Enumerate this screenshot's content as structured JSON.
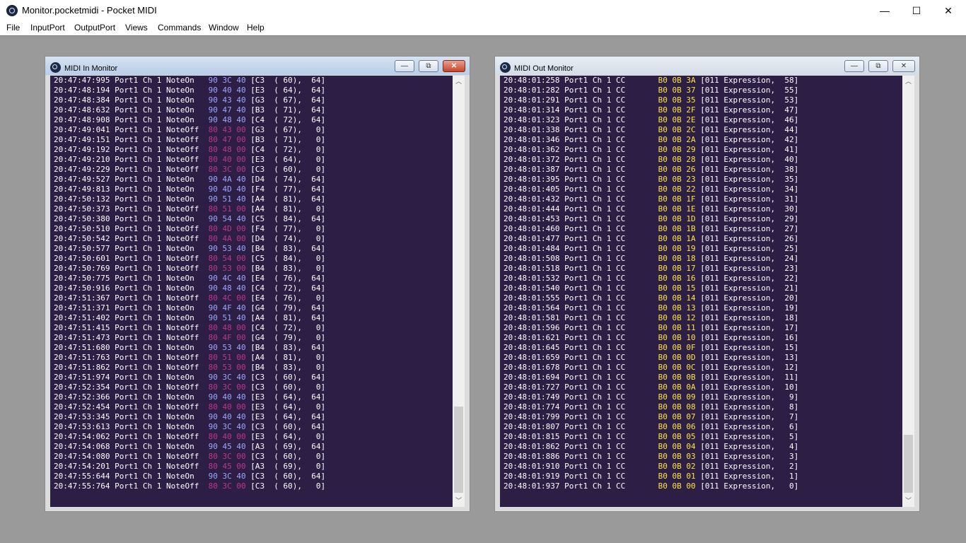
{
  "window": {
    "title": "Monitor.pocketmidi - Pocket MIDI",
    "controls": {
      "minimize": "—",
      "maximize": "☐",
      "close": "✕"
    }
  },
  "menu": [
    "File",
    "InputPort",
    "OutputPort",
    "Views",
    "Commands",
    "Window",
    "Help"
  ],
  "colors": {
    "log_background": "#2c1e45",
    "note_on_bytes": "#9ea7ff",
    "note_off_bytes": "#c0368e",
    "cc_bytes": "#ffe43a"
  },
  "in_monitor": {
    "title": "MIDI In Monitor",
    "buttons": {
      "minimize": "—",
      "restore": "⧉",
      "close": "✕"
    },
    "rows": [
      {
        "time": "20:47:47:995",
        "port": "Port1",
        "ch": "Ch 1",
        "type": "NoteOn ",
        "bytes": "90 3C 40",
        "detail": "[C3  ( 60),  64]"
      },
      {
        "time": "20:47:48:194",
        "port": "Port1",
        "ch": "Ch 1",
        "type": "NoteOn ",
        "bytes": "90 40 40",
        "detail": "[E3  ( 64),  64]"
      },
      {
        "time": "20:47:48:384",
        "port": "Port1",
        "ch": "Ch 1",
        "type": "NoteOn ",
        "bytes": "90 43 40",
        "detail": "[G3  ( 67),  64]"
      },
      {
        "time": "20:47:48:632",
        "port": "Port1",
        "ch": "Ch 1",
        "type": "NoteOn ",
        "bytes": "90 47 40",
        "detail": "[B3  ( 71),  64]"
      },
      {
        "time": "20:47:48:908",
        "port": "Port1",
        "ch": "Ch 1",
        "type": "NoteOn ",
        "bytes": "90 48 40",
        "detail": "[C4  ( 72),  64]"
      },
      {
        "time": "20:47:49:041",
        "port": "Port1",
        "ch": "Ch 1",
        "type": "NoteOff",
        "bytes": "80 43 00",
        "detail": "[G3  ( 67),   0]"
      },
      {
        "time": "20:47:49:151",
        "port": "Port1",
        "ch": "Ch 1",
        "type": "NoteOff",
        "bytes": "80 47 00",
        "detail": "[B3  ( 71),   0]"
      },
      {
        "time": "20:47:49:192",
        "port": "Port1",
        "ch": "Ch 1",
        "type": "NoteOff",
        "bytes": "80 48 00",
        "detail": "[C4  ( 72),   0]"
      },
      {
        "time": "20:47:49:210",
        "port": "Port1",
        "ch": "Ch 1",
        "type": "NoteOff",
        "bytes": "80 40 00",
        "detail": "[E3  ( 64),   0]"
      },
      {
        "time": "20:47:49:229",
        "port": "Port1",
        "ch": "Ch 1",
        "type": "NoteOff",
        "bytes": "80 3C 00",
        "detail": "[C3  ( 60),   0]"
      },
      {
        "time": "20:47:49:527",
        "port": "Port1",
        "ch": "Ch 1",
        "type": "NoteOn ",
        "bytes": "90 4A 40",
        "detail": "[D4  ( 74),  64]"
      },
      {
        "time": "20:47:49:813",
        "port": "Port1",
        "ch": "Ch 1",
        "type": "NoteOn ",
        "bytes": "90 4D 40",
        "detail": "[F4  ( 77),  64]"
      },
      {
        "time": "20:47:50:132",
        "port": "Port1",
        "ch": "Ch 1",
        "type": "NoteOn ",
        "bytes": "90 51 40",
        "detail": "[A4  ( 81),  64]"
      },
      {
        "time": "20:47:50:373",
        "port": "Port1",
        "ch": "Ch 1",
        "type": "NoteOff",
        "bytes": "80 51 00",
        "detail": "[A4  ( 81),   0]"
      },
      {
        "time": "20:47:50:380",
        "port": "Port1",
        "ch": "Ch 1",
        "type": "NoteOn ",
        "bytes": "90 54 40",
        "detail": "[C5  ( 84),  64]"
      },
      {
        "time": "20:47:50:510",
        "port": "Port1",
        "ch": "Ch 1",
        "type": "NoteOff",
        "bytes": "80 4D 00",
        "detail": "[F4  ( 77),   0]"
      },
      {
        "time": "20:47:50:542",
        "port": "Port1",
        "ch": "Ch 1",
        "type": "NoteOff",
        "bytes": "80 4A 00",
        "detail": "[D4  ( 74),   0]"
      },
      {
        "time": "20:47:50:577",
        "port": "Port1",
        "ch": "Ch 1",
        "type": "NoteOn ",
        "bytes": "90 53 40",
        "detail": "[B4  ( 83),  64]"
      },
      {
        "time": "20:47:50:601",
        "port": "Port1",
        "ch": "Ch 1",
        "type": "NoteOff",
        "bytes": "80 54 00",
        "detail": "[C5  ( 84),   0]"
      },
      {
        "time": "20:47:50:769",
        "port": "Port1",
        "ch": "Ch 1",
        "type": "NoteOff",
        "bytes": "80 53 00",
        "detail": "[B4  ( 83),   0]"
      },
      {
        "time": "20:47:50:775",
        "port": "Port1",
        "ch": "Ch 1",
        "type": "NoteOn ",
        "bytes": "90 4C 40",
        "detail": "[E4  ( 76),  64]"
      },
      {
        "time": "20:47:50:916",
        "port": "Port1",
        "ch": "Ch 1",
        "type": "NoteOn ",
        "bytes": "90 48 40",
        "detail": "[C4  ( 72),  64]"
      },
      {
        "time": "20:47:51:367",
        "port": "Port1",
        "ch": "Ch 1",
        "type": "NoteOff",
        "bytes": "80 4C 00",
        "detail": "[E4  ( 76),   0]"
      },
      {
        "time": "20:47:51:371",
        "port": "Port1",
        "ch": "Ch 1",
        "type": "NoteOn ",
        "bytes": "90 4F 40",
        "detail": "[G4  ( 79),  64]"
      },
      {
        "time": "20:47:51:402",
        "port": "Port1",
        "ch": "Ch 1",
        "type": "NoteOn ",
        "bytes": "90 51 40",
        "detail": "[A4  ( 81),  64]"
      },
      {
        "time": "20:47:51:415",
        "port": "Port1",
        "ch": "Ch 1",
        "type": "NoteOff",
        "bytes": "80 48 00",
        "detail": "[C4  ( 72),   0]"
      },
      {
        "time": "20:47:51:473",
        "port": "Port1",
        "ch": "Ch 1",
        "type": "NoteOff",
        "bytes": "80 4F 00",
        "detail": "[G4  ( 79),   0]"
      },
      {
        "time": "20:47:51:680",
        "port": "Port1",
        "ch": "Ch 1",
        "type": "NoteOn ",
        "bytes": "90 53 40",
        "detail": "[B4  ( 83),  64]"
      },
      {
        "time": "20:47:51:763",
        "port": "Port1",
        "ch": "Ch 1",
        "type": "NoteOff",
        "bytes": "80 51 00",
        "detail": "[A4  ( 81),   0]"
      },
      {
        "time": "20:47:51:862",
        "port": "Port1",
        "ch": "Ch 1",
        "type": "NoteOff",
        "bytes": "80 53 00",
        "detail": "[B4  ( 83),   0]"
      },
      {
        "time": "20:47:51:974",
        "port": "Port1",
        "ch": "Ch 1",
        "type": "NoteOn ",
        "bytes": "90 3C 40",
        "detail": "[C3  ( 60),  64]"
      },
      {
        "time": "20:47:52:354",
        "port": "Port1",
        "ch": "Ch 1",
        "type": "NoteOff",
        "bytes": "80 3C 00",
        "detail": "[C3  ( 60),   0]"
      },
      {
        "time": "20:47:52:366",
        "port": "Port1",
        "ch": "Ch 1",
        "type": "NoteOn ",
        "bytes": "90 40 40",
        "detail": "[E3  ( 64),  64]"
      },
      {
        "time": "20:47:52:454",
        "port": "Port1",
        "ch": "Ch 1",
        "type": "NoteOff",
        "bytes": "80 40 00",
        "detail": "[E3  ( 64),   0]"
      },
      {
        "time": "20:47:53:345",
        "port": "Port1",
        "ch": "Ch 1",
        "type": "NoteOn ",
        "bytes": "90 40 40",
        "detail": "[E3  ( 64),  64]"
      },
      {
        "time": "20:47:53:613",
        "port": "Port1",
        "ch": "Ch 1",
        "type": "NoteOn ",
        "bytes": "90 3C 40",
        "detail": "[C3  ( 60),  64]"
      },
      {
        "time": "20:47:54:062",
        "port": "Port1",
        "ch": "Ch 1",
        "type": "NoteOff",
        "bytes": "80 40 00",
        "detail": "[E3  ( 64),   0]"
      },
      {
        "time": "20:47:54:068",
        "port": "Port1",
        "ch": "Ch 1",
        "type": "NoteOn ",
        "bytes": "90 45 40",
        "detail": "[A3  ( 69),  64]"
      },
      {
        "time": "20:47:54:080",
        "port": "Port1",
        "ch": "Ch 1",
        "type": "NoteOff",
        "bytes": "80 3C 00",
        "detail": "[C3  ( 60),   0]"
      },
      {
        "time": "20:47:54:201",
        "port": "Port1",
        "ch": "Ch 1",
        "type": "NoteOff",
        "bytes": "80 45 00",
        "detail": "[A3  ( 69),   0]"
      },
      {
        "time": "20:47:55:644",
        "port": "Port1",
        "ch": "Ch 1",
        "type": "NoteOn ",
        "bytes": "90 3C 40",
        "detail": "[C3  ( 60),  64]"
      },
      {
        "time": "20:47:55:764",
        "port": "Port1",
        "ch": "Ch 1",
        "type": "NoteOff",
        "bytes": "80 3C 00",
        "detail": "[C3  ( 60),   0]"
      }
    ]
  },
  "out_monitor": {
    "title": "MIDI Out Monitor",
    "buttons": {
      "minimize": "—",
      "restore": "⧉",
      "close": "✕"
    },
    "rows": [
      {
        "time": "20:48:01:258",
        "port": "Port1",
        "ch": "Ch 1",
        "type": "CC     ",
        "bytes": "B0 0B 3A",
        "detail": "[011 Expression,  58]"
      },
      {
        "time": "20:48:01:282",
        "port": "Port1",
        "ch": "Ch 1",
        "type": "CC     ",
        "bytes": "B0 0B 37",
        "detail": "[011 Expression,  55]"
      },
      {
        "time": "20:48:01:291",
        "port": "Port1",
        "ch": "Ch 1",
        "type": "CC     ",
        "bytes": "B0 0B 35",
        "detail": "[011 Expression,  53]"
      },
      {
        "time": "20:48:01:314",
        "port": "Port1",
        "ch": "Ch 1",
        "type": "CC     ",
        "bytes": "B0 0B 2F",
        "detail": "[011 Expression,  47]"
      },
      {
        "time": "20:48:01:323",
        "port": "Port1",
        "ch": "Ch 1",
        "type": "CC     ",
        "bytes": "B0 0B 2E",
        "detail": "[011 Expression,  46]"
      },
      {
        "time": "20:48:01:338",
        "port": "Port1",
        "ch": "Ch 1",
        "type": "CC     ",
        "bytes": "B0 0B 2C",
        "detail": "[011 Expression,  44]"
      },
      {
        "time": "20:48:01:346",
        "port": "Port1",
        "ch": "Ch 1",
        "type": "CC     ",
        "bytes": "B0 0B 2A",
        "detail": "[011 Expression,  42]"
      },
      {
        "time": "20:48:01:362",
        "port": "Port1",
        "ch": "Ch 1",
        "type": "CC     ",
        "bytes": "B0 0B 29",
        "detail": "[011 Expression,  41]"
      },
      {
        "time": "20:48:01:372",
        "port": "Port1",
        "ch": "Ch 1",
        "type": "CC     ",
        "bytes": "B0 0B 28",
        "detail": "[011 Expression,  40]"
      },
      {
        "time": "20:48:01:387",
        "port": "Port1",
        "ch": "Ch 1",
        "type": "CC     ",
        "bytes": "B0 0B 26",
        "detail": "[011 Expression,  38]"
      },
      {
        "time": "20:48:01:395",
        "port": "Port1",
        "ch": "Ch 1",
        "type": "CC     ",
        "bytes": "B0 0B 23",
        "detail": "[011 Expression,  35]"
      },
      {
        "time": "20:48:01:405",
        "port": "Port1",
        "ch": "Ch 1",
        "type": "CC     ",
        "bytes": "B0 0B 22",
        "detail": "[011 Expression,  34]"
      },
      {
        "time": "20:48:01:432",
        "port": "Port1",
        "ch": "Ch 1",
        "type": "CC     ",
        "bytes": "B0 0B 1F",
        "detail": "[011 Expression,  31]"
      },
      {
        "time": "20:48:01:444",
        "port": "Port1",
        "ch": "Ch 1",
        "type": "CC     ",
        "bytes": "B0 0B 1E",
        "detail": "[011 Expression,  30]"
      },
      {
        "time": "20:48:01:453",
        "port": "Port1",
        "ch": "Ch 1",
        "type": "CC     ",
        "bytes": "B0 0B 1D",
        "detail": "[011 Expression,  29]"
      },
      {
        "time": "20:48:01:460",
        "port": "Port1",
        "ch": "Ch 1",
        "type": "CC     ",
        "bytes": "B0 0B 1B",
        "detail": "[011 Expression,  27]"
      },
      {
        "time": "20:48:01:477",
        "port": "Port1",
        "ch": "Ch 1",
        "type": "CC     ",
        "bytes": "B0 0B 1A",
        "detail": "[011 Expression,  26]"
      },
      {
        "time": "20:48:01:484",
        "port": "Port1",
        "ch": "Ch 1",
        "type": "CC     ",
        "bytes": "B0 0B 19",
        "detail": "[011 Expression,  25]"
      },
      {
        "time": "20:48:01:508",
        "port": "Port1",
        "ch": "Ch 1",
        "type": "CC     ",
        "bytes": "B0 0B 18",
        "detail": "[011 Expression,  24]"
      },
      {
        "time": "20:48:01:518",
        "port": "Port1",
        "ch": "Ch 1",
        "type": "CC     ",
        "bytes": "B0 0B 17",
        "detail": "[011 Expression,  23]"
      },
      {
        "time": "20:48:01:532",
        "port": "Port1",
        "ch": "Ch 1",
        "type": "CC     ",
        "bytes": "B0 0B 16",
        "detail": "[011 Expression,  22]"
      },
      {
        "time": "20:48:01:540",
        "port": "Port1",
        "ch": "Ch 1",
        "type": "CC     ",
        "bytes": "B0 0B 15",
        "detail": "[011 Expression,  21]"
      },
      {
        "time": "20:48:01:555",
        "port": "Port1",
        "ch": "Ch 1",
        "type": "CC     ",
        "bytes": "B0 0B 14",
        "detail": "[011 Expression,  20]"
      },
      {
        "time": "20:48:01:564",
        "port": "Port1",
        "ch": "Ch 1",
        "type": "CC     ",
        "bytes": "B0 0B 13",
        "detail": "[011 Expression,  19]"
      },
      {
        "time": "20:48:01:581",
        "port": "Port1",
        "ch": "Ch 1",
        "type": "CC     ",
        "bytes": "B0 0B 12",
        "detail": "[011 Expression,  18]"
      },
      {
        "time": "20:48:01:596",
        "port": "Port1",
        "ch": "Ch 1",
        "type": "CC     ",
        "bytes": "B0 0B 11",
        "detail": "[011 Expression,  17]"
      },
      {
        "time": "20:48:01:621",
        "port": "Port1",
        "ch": "Ch 1",
        "type": "CC     ",
        "bytes": "B0 0B 10",
        "detail": "[011 Expression,  16]"
      },
      {
        "time": "20:48:01:645",
        "port": "Port1",
        "ch": "Ch 1",
        "type": "CC     ",
        "bytes": "B0 0B 0F",
        "detail": "[011 Expression,  15]"
      },
      {
        "time": "20:48:01:659",
        "port": "Port1",
        "ch": "Ch 1",
        "type": "CC     ",
        "bytes": "B0 0B 0D",
        "detail": "[011 Expression,  13]"
      },
      {
        "time": "20:48:01:678",
        "port": "Port1",
        "ch": "Ch 1",
        "type": "CC     ",
        "bytes": "B0 0B 0C",
        "detail": "[011 Expression,  12]"
      },
      {
        "time": "20:48:01:694",
        "port": "Port1",
        "ch": "Ch 1",
        "type": "CC     ",
        "bytes": "B0 0B 0B",
        "detail": "[011 Expression,  11]"
      },
      {
        "time": "20:48:01:727",
        "port": "Port1",
        "ch": "Ch 1",
        "type": "CC     ",
        "bytes": "B0 0B 0A",
        "detail": "[011 Expression,  10]"
      },
      {
        "time": "20:48:01:749",
        "port": "Port1",
        "ch": "Ch 1",
        "type": "CC     ",
        "bytes": "B0 0B 09",
        "detail": "[011 Expression,   9]"
      },
      {
        "time": "20:48:01:774",
        "port": "Port1",
        "ch": "Ch 1",
        "type": "CC     ",
        "bytes": "B0 0B 08",
        "detail": "[011 Expression,   8]"
      },
      {
        "time": "20:48:01:799",
        "port": "Port1",
        "ch": "Ch 1",
        "type": "CC     ",
        "bytes": "B0 0B 07",
        "detail": "[011 Expression,   7]"
      },
      {
        "time": "20:48:01:807",
        "port": "Port1",
        "ch": "Ch 1",
        "type": "CC     ",
        "bytes": "B0 0B 06",
        "detail": "[011 Expression,   6]"
      },
      {
        "time": "20:48:01:815",
        "port": "Port1",
        "ch": "Ch 1",
        "type": "CC     ",
        "bytes": "B0 0B 05",
        "detail": "[011 Expression,   5]"
      },
      {
        "time": "20:48:01:862",
        "port": "Port1",
        "ch": "Ch 1",
        "type": "CC     ",
        "bytes": "B0 0B 04",
        "detail": "[011 Expression,   4]"
      },
      {
        "time": "20:48:01:886",
        "port": "Port1",
        "ch": "Ch 1",
        "type": "CC     ",
        "bytes": "B0 0B 03",
        "detail": "[011 Expression,   3]"
      },
      {
        "time": "20:48:01:910",
        "port": "Port1",
        "ch": "Ch 1",
        "type": "CC     ",
        "bytes": "B0 0B 02",
        "detail": "[011 Expression,   2]"
      },
      {
        "time": "20:48:01:919",
        "port": "Port1",
        "ch": "Ch 1",
        "type": "CC     ",
        "bytes": "B0 0B 01",
        "detail": "[011 Expression,   1]"
      },
      {
        "time": "20:48:01:937",
        "port": "Port1",
        "ch": "Ch 1",
        "type": "CC     ",
        "bytes": "B0 0B 00",
        "detail": "[011 Expression,   0]"
      }
    ]
  }
}
